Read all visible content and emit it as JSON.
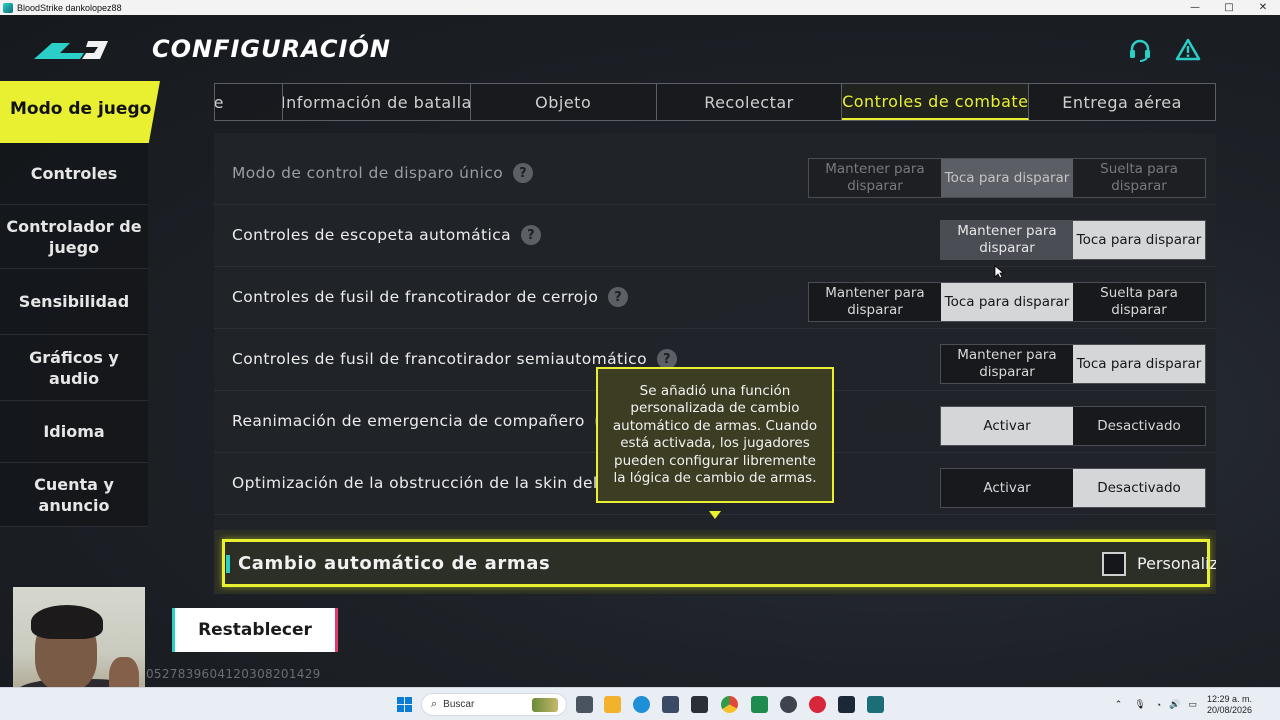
{
  "window": {
    "title": "BloodStrike dankolopez88",
    "controls": [
      "—",
      "□",
      "✕"
    ]
  },
  "header": {
    "title": "CONFIGURACIÓN",
    "support_icon": "headset-icon",
    "alert_icon": "warning-icon"
  },
  "sidebar": {
    "active": "Modo de juego",
    "items": [
      "Controles",
      "Controlador de juego",
      "Sensibilidad",
      "Gráficos y audio",
      "Idioma",
      "Cuenta y anuncio"
    ]
  },
  "tabs": [
    {
      "label": "e",
      "active": false
    },
    {
      "label": "Información de batalla",
      "active": false
    },
    {
      "label": "Objeto",
      "active": false
    },
    {
      "label": "Recolectar",
      "active": false
    },
    {
      "label": "Controles de combate",
      "active": true
    },
    {
      "label": "Entrega aérea",
      "active": false
    }
  ],
  "settings": [
    {
      "label": "Modo de control de disparo único",
      "dim": true,
      "options": [
        "Mantener para disparar",
        "Toca para disparar",
        "Suelta para disparar"
      ],
      "selected": 1
    },
    {
      "label": "Controles de escopeta automática",
      "dim": false,
      "options": [
        "Mantener para disparar",
        "Toca para disparar"
      ],
      "selected": 1
    },
    {
      "label": "Controles de fusil de francotirador de cerrojo",
      "dim": false,
      "options": [
        "Mantener para disparar",
        "Toca para disparar",
        "Suelta para disparar"
      ],
      "selected": 1
    },
    {
      "label": "Controles de fusil de francotirador semiautomático",
      "dim": false,
      "options": [
        "Mantener para disparar",
        "Toca para disparar"
      ],
      "selected": 1
    },
    {
      "label": "Reanimación de emergencia de compañero",
      "dim": false,
      "options": [
        "Activar",
        "Desactivado"
      ],
      "selected": 0
    },
    {
      "label": "Optimización de la obstrucción de la skin del Striker en TPS",
      "dim": false,
      "options": [
        "Activar",
        "Desactivado"
      ],
      "selected": 1
    }
  ],
  "auto_switch": {
    "title": "Cambio automático de armas",
    "checkbox_label": "Personaliz",
    "checked": false
  },
  "tooltip": {
    "text": "Se añadió una función personalizada de cambio automático de armas. Cuando está activada, los jugadores pueden configurar libremente la lógica de cambio de armas."
  },
  "reset_button": {
    "label": "Restablecer"
  },
  "user_id": "0527839604120308201429",
  "taskbar": {
    "search_placeholder": "Buscar",
    "time": "12:29 a. m.",
    "date": "20/08/2026"
  },
  "colors": {
    "accent": "#e9f032",
    "teal": "#2ad0c8",
    "panel": "#202329"
  }
}
